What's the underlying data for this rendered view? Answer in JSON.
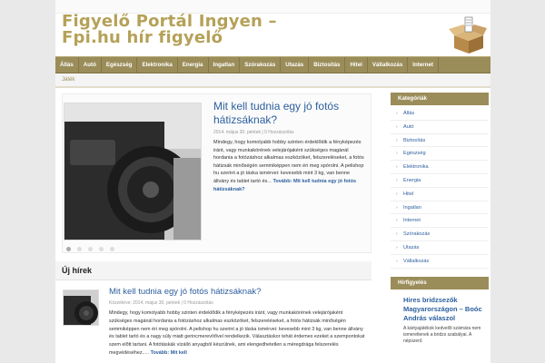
{
  "site": {
    "title_line1": "Figyelő Portál Ingyen –",
    "title_line2": "Fpi.hu hír figyelő"
  },
  "nav": {
    "items": [
      "Állás",
      "Autó",
      "Egészség",
      "Elektronika",
      "Energia",
      "Ingatlan",
      "Szórakozás",
      "Utazás",
      "Biztosítás",
      "Hitel",
      "Vállalkozás",
      "Internet"
    ],
    "sub_items": [
      "Játék"
    ]
  },
  "slider": {
    "title": "Mit kell tudnia egy jó fotós hátizsáknak?",
    "meta": "2014. május 30. péntek  |  0 Hozzászólás",
    "excerpt": "Mindegy, hogy komolyabb hobby szinten érdeklődik a fényképezés iránt, vagy munkakörének velejárójaként szükséges magánál hordania a fotózáshoz alkalmas eszközöket, felszereléseket, a fotós hátizsák minőségén semmiképpen nem éri meg spórolni. A pelishop hu szerint a jó táska ismérvei: kevesebb mint 3 kg, van benne állvány és tablet tartó és...",
    "more": "Tovább: Mit kell tudnia egy jó fotós hátizsáknak?"
  },
  "news": {
    "heading": "Új hírek",
    "post": {
      "title": "Mit kell tudnia egy jó fotós hátizsáknak?",
      "meta": "Közzétéve: 2014. május 30. péntek  |  0 Hozzászólás",
      "excerpt": "Mindegy, hogy komolyabb hobby szinten érdeklődik a fényképezés iránt, vagy munkakörének velejárójaként szükséges magánál hordania a fotózáshoz alkalmas eszközöket, felszereléseket, a fotós hátizsák minőségén semmiképpen nem éri meg spórolni. A pelishop hu szerint a jó táska ismérvei: kevesebb mint 3 kg, van benne állvány és tablet tartó és a nagy súly miatt gerincmerevítővel rendelkezik. Választáskor tehát érdemes ezeket a szempontokat szem előtt tartani. A fotótáskák vízálló anyagból készülnek, ami elengedhetetlen a méregdrága felszerelés megvédéséhez.....",
      "more": "Tovább: Mit kell"
    }
  },
  "sidebar": {
    "categories_title": "Kategóriák",
    "categories": [
      "Állás",
      "Autó",
      "Biztosítás",
      "Egészség",
      "Elektronika",
      "Energia",
      "Hitel",
      "Ingatlan",
      "Internet",
      "Szórakozás",
      "Utazás",
      "Vállalkozás"
    ],
    "ads_title": "Hirfigyelés",
    "ad_headline": "Hires bridzsezők Magyarországon – Boóc András válaszol",
    "ad_text": "A kártyajátékok kedvelői számára nem ismeretlenek a bridzs szabályai. A népszerű"
  },
  "colors": {
    "accent": "#9b8d5a",
    "title": "#b5a158",
    "link": "#2d5f9e"
  }
}
